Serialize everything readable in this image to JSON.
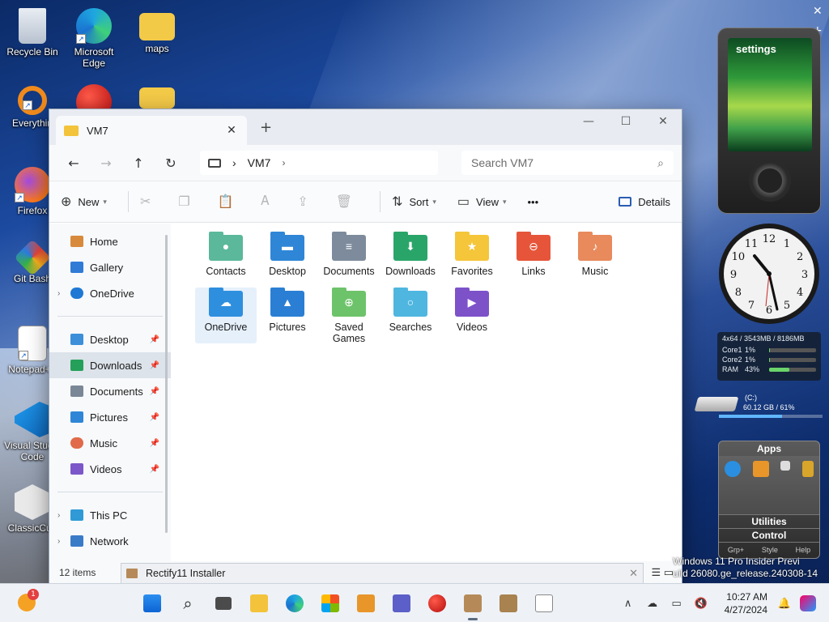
{
  "desktop": {
    "icons": [
      {
        "label": "Recycle Bin"
      },
      {
        "label": "Microsoft Edge"
      },
      {
        "label": "maps"
      },
      {
        "label": "Everythin"
      },
      {
        "label": "Firefox"
      },
      {
        "label": "Git Bash"
      },
      {
        "label": "Notepad++"
      },
      {
        "label": "Visual Studio Code"
      },
      {
        "label": "ClassicCub"
      }
    ],
    "watermark_line1": "Windows 11 Pro Insider Previ",
    "watermark_line2": "uild 26080.ge_release.240308-14"
  },
  "explorer": {
    "tab_title": "VM7",
    "tab_close": "✕",
    "new_tab": "+",
    "window_controls": {
      "minimize": "—",
      "maximize": "☐",
      "close": "✕"
    },
    "nav": {
      "back": "←",
      "forward": "→",
      "up": "↑",
      "refresh": "↻"
    },
    "breadcrumb": {
      "sep1": "›",
      "folder": "VM7",
      "sep2": "›"
    },
    "search": {
      "placeholder": "Search VM7",
      "icon": "⌕"
    },
    "toolbar": {
      "new_label": "New",
      "sort_label": "Sort",
      "view_label": "View",
      "more_label": "•••",
      "details_label": "Details"
    },
    "sidebar": {
      "top": [
        {
          "label": "Home",
          "color": "#d88a3c"
        },
        {
          "label": "Gallery",
          "color": "#2f7bd6"
        },
        {
          "label": "OneDrive",
          "color": "#1e78d4"
        }
      ],
      "quick": [
        {
          "label": "Desktop",
          "color": "#3c8fd8"
        },
        {
          "label": "Downloads",
          "color": "#25a05a"
        },
        {
          "label": "Documents",
          "color": "#7a8796"
        },
        {
          "label": "Pictures",
          "color": "#2f86d6"
        },
        {
          "label": "Music",
          "color": "#e06a4a"
        },
        {
          "label": "Videos",
          "color": "#7b57c9"
        }
      ],
      "bottom": [
        {
          "label": "This PC",
          "color": "#2f9ad6"
        },
        {
          "label": "Network",
          "color": "#3a7bc8"
        }
      ]
    },
    "folders": [
      {
        "label": "Contacts",
        "color": "#5bb89a",
        "sym": "●"
      },
      {
        "label": "Desktop",
        "color": "#2f86d6",
        "sym": "▬"
      },
      {
        "label": "Documents",
        "color": "#7d8b9c",
        "sym": "≡"
      },
      {
        "label": "Downloads",
        "color": "#2aa56a",
        "sym": "⬇"
      },
      {
        "label": "Favorites",
        "color": "#f5c53a",
        "sym": "★"
      },
      {
        "label": "Links",
        "color": "#e6553a",
        "sym": "⊖"
      },
      {
        "label": "Music",
        "color": "#e88a5c",
        "sym": "♪"
      },
      {
        "label": "OneDrive",
        "color": "#2f8fdf",
        "sym": "☁"
      },
      {
        "label": "Pictures",
        "color": "#2a7fd4",
        "sym": "▲"
      },
      {
        "label": "Saved Games",
        "color": "#6dc36a",
        "sym": "⊕"
      },
      {
        "label": "Searches",
        "color": "#4fb6e0",
        "sym": "○"
      },
      {
        "label": "Videos",
        "color": "#7d52c9",
        "sym": "▶"
      }
    ],
    "status": {
      "count": "12 items"
    }
  },
  "installer_bar": {
    "label": "Rectify11 Installer",
    "close": "✕"
  },
  "gadgets": {
    "player_label": "settings",
    "sysmon": {
      "header": "4x64 / 3543MB / 8186MB",
      "rows": [
        {
          "name": "Core1",
          "pct": "1%",
          "fill": 0.01
        },
        {
          "name": "Core2",
          "pct": "1%",
          "fill": 0.01
        },
        {
          "name": "RAM",
          "pct": "43%",
          "fill": 0.43
        }
      ]
    },
    "drive": {
      "label": "(C:)",
      "info": "60.12 GB / 61%",
      "fill": 0.61
    },
    "apps": {
      "title": "Apps",
      "utilities": "Utilities",
      "control": "Control",
      "footer": [
        "Grp+",
        "Style",
        "Help"
      ]
    }
  },
  "taskbar": {
    "weather_badge": "1",
    "time": "10:27 AM",
    "date": "4/27/2024"
  }
}
